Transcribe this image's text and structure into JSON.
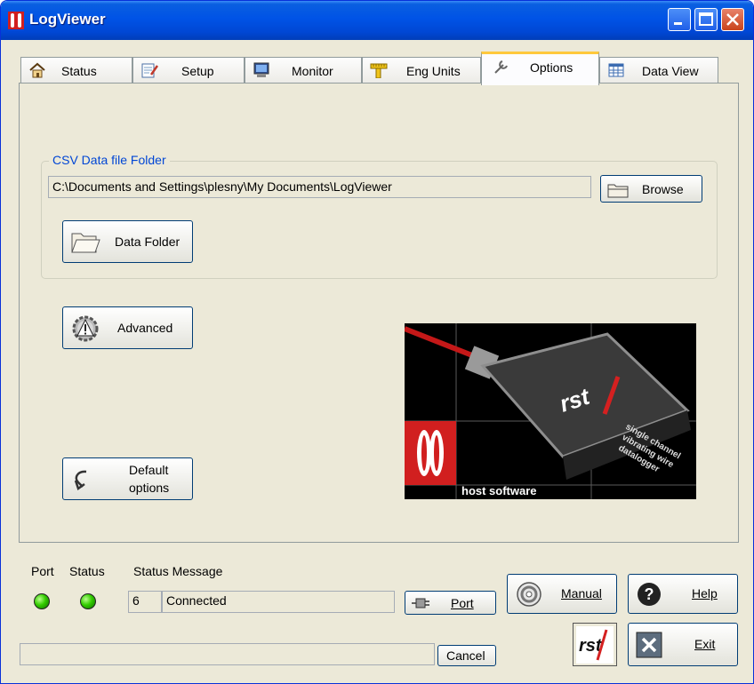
{
  "window": {
    "title": "LogViewer"
  },
  "tabs": [
    {
      "label": "Status",
      "icon": "house-icon"
    },
    {
      "label": "Setup",
      "icon": "notepad-pencil-icon"
    },
    {
      "label": "Monitor",
      "icon": "monitor-icon"
    },
    {
      "label": "Eng Units",
      "icon": "ruler-icon"
    },
    {
      "label": "Options",
      "icon": "wrench-icon",
      "active": true
    },
    {
      "label": "Data View",
      "icon": "table-icon"
    }
  ],
  "options": {
    "csv_group_label": "CSV Data file Folder",
    "csv_path": "C:\\Documents and Settings\\plesny\\My Documents\\LogViewer",
    "browse_label": "Browse",
    "data_folder_label": "Data Folder",
    "advanced_label": "Advanced",
    "default_options_line1": "Default",
    "default_options_line2": "options",
    "image": {
      "brand": "rst",
      "device_label_1": "single channel",
      "device_label_2": "vibrating wire",
      "device_label_3": "datalogger",
      "caption": "host software"
    }
  },
  "status": {
    "port_label": "Port",
    "status_label": "Status",
    "message_label": "Status Message",
    "port_number": "6",
    "message": "Connected",
    "port_button": "Port",
    "cancel_button": "Cancel",
    "progress": 0
  },
  "buttons": {
    "manual": "Manual",
    "help": "Help",
    "exit": "Exit",
    "logo": "rst"
  },
  "colors": {
    "titlebar": "#0053e6",
    "tab_highlight": "#ffc83c",
    "group_label": "#0046d5",
    "led_green": "#33cc00",
    "brand_red": "#d42020"
  }
}
